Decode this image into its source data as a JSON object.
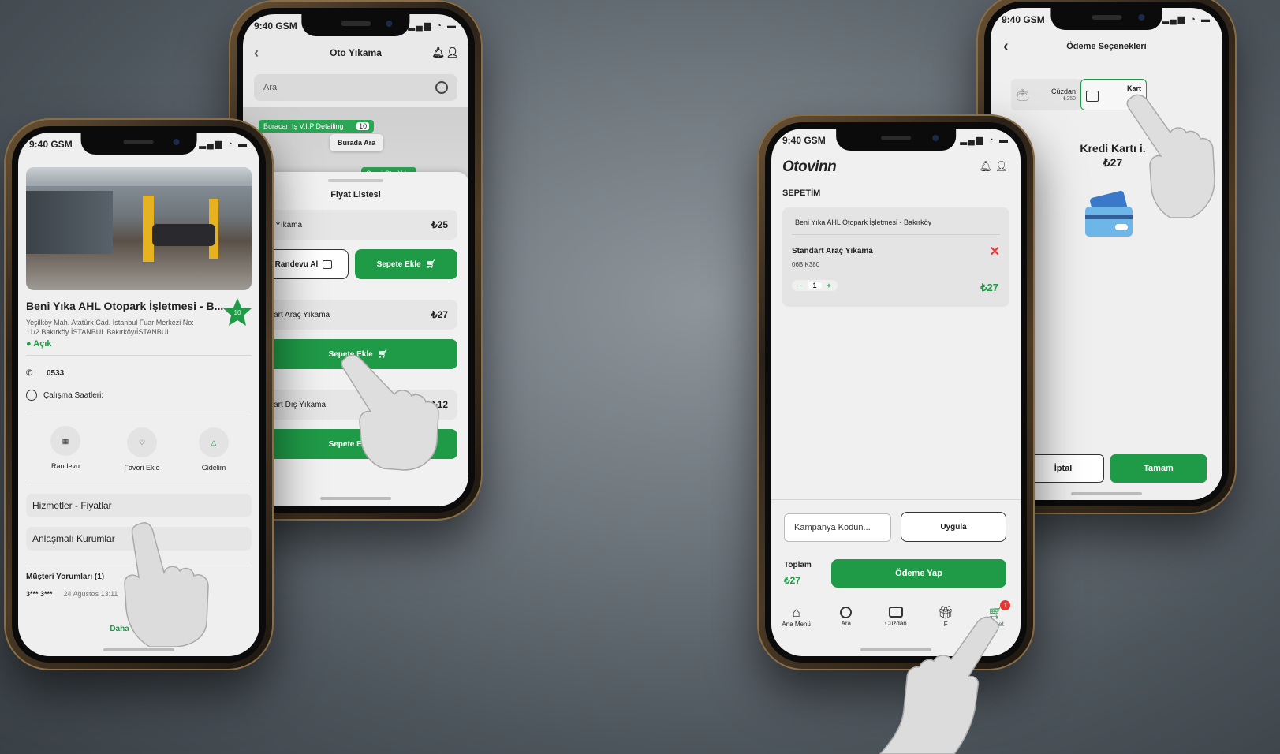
{
  "status_bar": {
    "time_carrier": "9:40 GSM"
  },
  "phone_detail": {
    "business_title": "Beni Yıka AHL Otopark İşletmesi - B...",
    "rating_badge": "10",
    "address_line1": "Yeşilköy Mah. Atatürk Cad. İstanbul Fuar Merkezi No:",
    "address_line2": "11/2 Bakırköy İSTANBUL Bakırköy/İSTANBUL",
    "open_status": "● Açık",
    "phone": "0533",
    "hours_label": "Çalışma Saatleri:",
    "actions": [
      {
        "label": "Randevu",
        "icon": "calendar-icon"
      },
      {
        "label": "Favori Ekle",
        "icon": "heart-icon"
      },
      {
        "label": "Gidelim",
        "icon": "navigate-icon"
      }
    ],
    "menu": [
      "Hizmetler - Fiyatlar",
      "Anlaşmalı Kurumlar"
    ],
    "reviews_title": "Müşteri Yorumları (1)",
    "review_user": "3*** 3***",
    "review_date": "24 Ağustos 13:11",
    "show_more": "Daha fazla göst"
  },
  "phone_prices": {
    "header_title": "Oto Yıkama",
    "search_placeholder": "Ara",
    "map_labels": [
      "Buracan Iş V.I.P Detailing",
      "Burada Ara",
      "Cami Oto Yıka"
    ],
    "map_badge": "10",
    "sheet_title": "Fiyat Listesi",
    "items": [
      {
        "name": "alı Yıkama",
        "price": "₺25"
      },
      {
        "name": "ndart Araç Yıkama",
        "price": "₺27"
      },
      {
        "name": "ndart Dış Yıkama",
        "price": "₺12"
      }
    ],
    "appointment_button": "Randevu Al",
    "add_to_cart": "Sepete Ekle"
  },
  "phone_cart": {
    "brand": "Otovinn",
    "section_title": "SEPETİM",
    "merchant": "Beni Yıka AHL Otopark İşletmesi - Bakırköy",
    "item_name": "Standart Araç Yıkama",
    "plate": "06BIK380",
    "qty_minus": "-",
    "qty": "1",
    "qty_plus": "+",
    "item_price": "₺27",
    "coupon_placeholder": "Kampanya Kodun...",
    "apply_button": "Uygula",
    "total_label": "Toplam",
    "total_value": "₺27",
    "pay_button": "Ödeme Yap",
    "nav": [
      {
        "label": "Ana Menü",
        "icon": "home-icon"
      },
      {
        "label": "Ara",
        "icon": "search-icon"
      },
      {
        "label": "Cüzdan",
        "icon": "wallet-icon"
      },
      {
        "label": "F",
        "icon": "gift-icon"
      },
      {
        "label": "Sepet",
        "icon": "cart-icon"
      }
    ],
    "cart_badge": "1"
  },
  "phone_payment": {
    "title": "Ödeme Seçenekleri",
    "wallet_label": "Cüzdan",
    "wallet_balance": "₺250",
    "card_label": "Kart",
    "method_title": "Kredi Kartı i.",
    "amount": "₺27",
    "cancel_button": "İptal",
    "ok_button": "Tamam"
  },
  "colors": {
    "accent": "#1f9a47",
    "danger": "#e53935"
  }
}
